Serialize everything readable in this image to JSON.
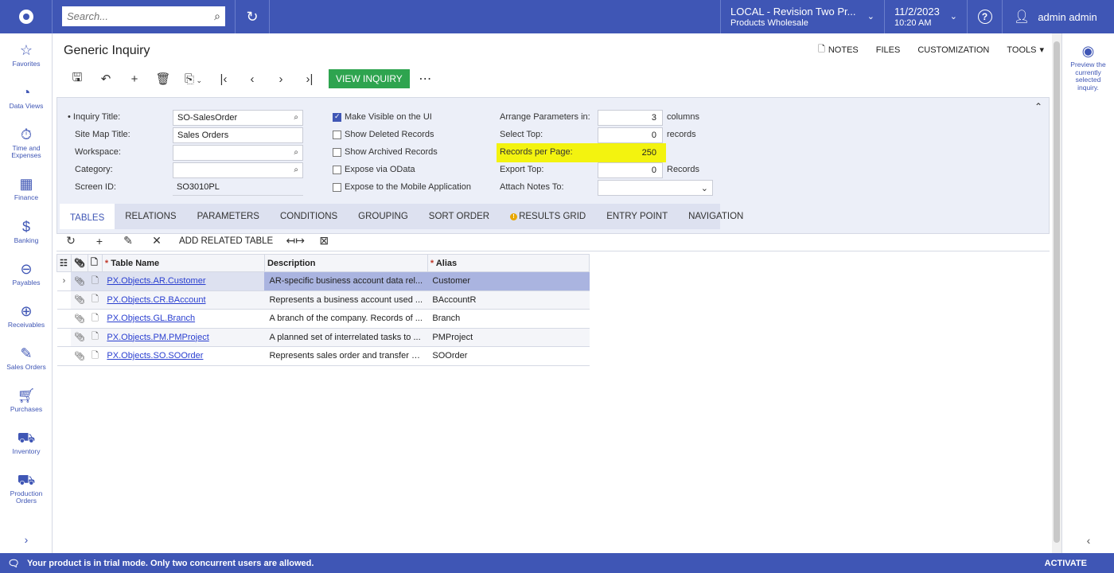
{
  "topbar": {
    "search_placeholder": "Search...",
    "tenant_name": "LOCAL - Revision Two Pr...",
    "branch": "Products Wholesale",
    "date": "11/2/2023",
    "time": "10:20 AM",
    "user": "admin admin"
  },
  "leftnav": {
    "items": [
      {
        "label": "Favorites",
        "icon": "star-icon",
        "glyph": "☆"
      },
      {
        "label": "Data Views",
        "icon": "pie-chart-icon",
        "glyph": "◔"
      },
      {
        "label": "Time and Expenses",
        "icon": "stopwatch-icon",
        "glyph": "⏱"
      },
      {
        "label": "Finance",
        "icon": "calculator-icon",
        "glyph": "▦"
      },
      {
        "label": "Banking",
        "icon": "dollar-icon",
        "glyph": "$"
      },
      {
        "label": "Payables",
        "icon": "minus-circle-icon",
        "glyph": "⊖"
      },
      {
        "label": "Receivables",
        "icon": "plus-circle-icon",
        "glyph": "⊕"
      },
      {
        "label": "Sales Orders",
        "icon": "pencil-icon",
        "glyph": "✎"
      },
      {
        "label": "Purchases",
        "icon": "cart-icon",
        "glyph": "🛒"
      },
      {
        "label": "Inventory",
        "icon": "truck-icon",
        "glyph": "⛟"
      },
      {
        "label": "Production Orders",
        "icon": "truck-icon",
        "glyph": "⛟"
      }
    ]
  },
  "rightpanel": {
    "text": "Preview the currently selected inquiry."
  },
  "page": {
    "title": "Generic Inquiry",
    "menu": {
      "notes": "NOTES",
      "files": "FILES",
      "customization": "CUSTOMIZATION",
      "tools": "TOOLS"
    },
    "view_inquiry": "VIEW INQUIRY"
  },
  "form": {
    "inquiry_title_label": "Inquiry Title:",
    "inquiry_title": "SO-SalesOrder",
    "site_map_title_label": "Site Map Title:",
    "site_map_title": "Sales Orders",
    "workspace_label": "Workspace:",
    "workspace": "",
    "category_label": "Category:",
    "category": "",
    "screen_id_label": "Screen ID:",
    "screen_id": "SO3010PL",
    "make_visible": "Make Visible on the UI",
    "make_visible_checked": true,
    "show_deleted": "Show Deleted Records",
    "show_archived": "Show Archived Records",
    "expose_odata": "Expose via OData",
    "expose_mobile": "Expose to the Mobile Application",
    "arrange_label": "Arrange Parameters in:",
    "arrange_value": "3",
    "arrange_suffix": "columns",
    "select_top_label": "Select Top:",
    "select_top_value": "0",
    "select_top_suffix": "records",
    "records_per_page_label": "Records per Page:",
    "records_per_page_value": "250",
    "export_top_label": "Export Top:",
    "export_top_value": "0",
    "export_top_suffix": "Records",
    "attach_notes_label": "Attach Notes To:",
    "attach_notes_value": "",
    "highlight_color": "#f3f30f"
  },
  "tabs": [
    "TABLES",
    "RELATIONS",
    "PARAMETERS",
    "CONDITIONS",
    "GROUPING",
    "SORT ORDER",
    "RESULTS GRID",
    "ENTRY POINT",
    "NAVIGATION"
  ],
  "grid_toolbar": {
    "add_related": "ADD RELATED TABLE"
  },
  "grid": {
    "headers": {
      "table_name": "Table Name",
      "description": "Description",
      "alias": "Alias"
    },
    "rows": [
      {
        "table": "PX.Objects.AR.Customer",
        "description": "AR-specific business account data rel...",
        "alias": "Customer"
      },
      {
        "table": "PX.Objects.CR.BAccount",
        "description": "Represents a business account used ...",
        "alias": "BAccountR"
      },
      {
        "table": "PX.Objects.GL.Branch",
        "description": "A branch of the company. Records of ...",
        "alias": "Branch"
      },
      {
        "table": "PX.Objects.PM.PMProject",
        "description": "A planned set of interrelated tasks to ...",
        "alias": "PMProject"
      },
      {
        "table": "PX.Objects.SO.SOOrder",
        "description": "Represents sales order and transfer o...",
        "alias": "SOOrder"
      }
    ]
  },
  "statusbar": {
    "message": "Your product is in trial mode. Only two concurrent users are allowed.",
    "activate": "ACTIVATE"
  },
  "colors": {
    "brand": "#3f56b5",
    "view_button": "#2ea44f",
    "link": "#2a3fd0"
  }
}
